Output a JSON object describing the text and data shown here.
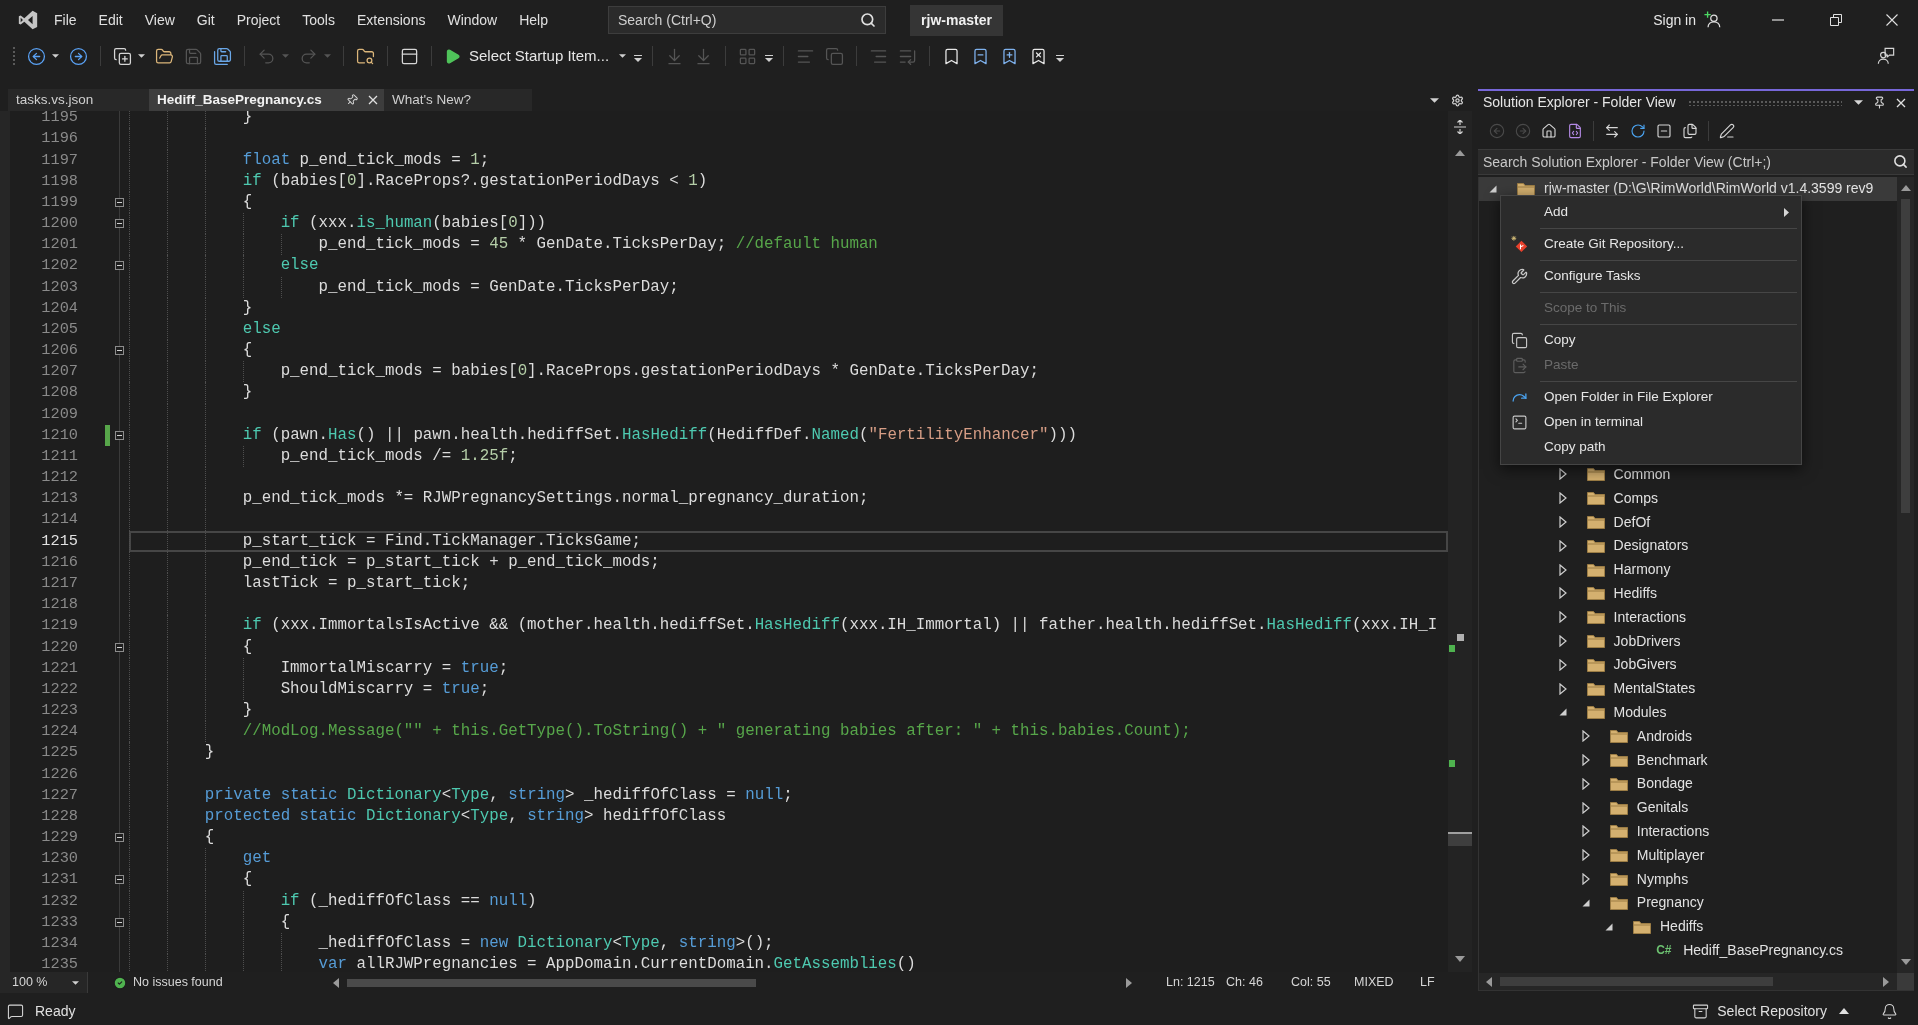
{
  "title_bar": {
    "menu": [
      "File",
      "Edit",
      "View",
      "Git",
      "Project",
      "Tools",
      "Extensions",
      "Window",
      "Help"
    ],
    "search": {
      "placeholder": "Search (Ctrl+Q)"
    },
    "solution": "rjw-master",
    "sign_in": "Sign in"
  },
  "toolbar": {
    "groups": [
      [
        {
          "kind": "icon",
          "disabled": false,
          "dropdown": true
        },
        {
          "kind": "icon",
          "disabled": false,
          "dropdown": false
        }
      ],
      [
        {
          "kind": "icon",
          "disabled": false,
          "dropdown": true
        },
        {
          "kind": "icon",
          "disabled": false,
          "dropdown": false
        },
        {
          "kind": "icon",
          "disabled": true,
          "dropdown": false
        },
        {
          "kind": "icon",
          "disabled": false,
          "dropdown": false
        }
      ],
      [
        {
          "kind": "icon",
          "disabled": true,
          "dropdown": true
        },
        {
          "kind": "icon",
          "disabled": true,
          "dropdown": true
        }
      ],
      [
        {
          "kind": "icon",
          "disabled": false,
          "dropdown": false
        }
      ],
      [
        {
          "kind": "icon",
          "disabled": false,
          "dropdown": false
        }
      ],
      [
        {
          "kind": "run",
          "label": "Select Startup Item...",
          "dropdown": true
        },
        {
          "kind": "overflow"
        }
      ],
      [
        {
          "kind": "icon",
          "disabled": true,
          "dropdown": false
        },
        {
          "kind": "icon",
          "disabled": true,
          "dropdown": false
        }
      ],
      [
        {
          "kind": "icon",
          "disabled": true,
          "dropdown": false
        },
        {
          "kind": "overflow"
        }
      ],
      [
        {
          "kind": "icon",
          "disabled": true,
          "dropdown": false
        },
        {
          "kind": "icon",
          "disabled": true,
          "dropdown": false
        }
      ],
      [
        {
          "kind": "icon",
          "disabled": true,
          "dropdown": false
        },
        {
          "kind": "icon",
          "disabled": true,
          "dropdown": false
        }
      ],
      [
        {
          "kind": "icon",
          "disabled": false,
          "dropdown": false
        },
        {
          "kind": "icon",
          "disabled": false,
          "dropdown": false
        },
        {
          "kind": "icon",
          "disabled": false,
          "dropdown": false
        },
        {
          "kind": "icon",
          "disabled": false,
          "dropdown": false
        },
        {
          "kind": "overflow"
        }
      ]
    ]
  },
  "editor": {
    "tabs": [
      {
        "label": "tasks.vs.json",
        "selected": false
      },
      {
        "label": "Hediff_BasePregnancy.cs",
        "selected": true
      },
      {
        "label": "What's New?",
        "selected": false
      }
    ],
    "lines": [
      {
        "number": "1195",
        "fold": false,
        "changed": false,
        "current": false,
        "tokens": [
          {
            "kind": "plain",
            "text": "            }"
          }
        ]
      },
      {
        "number": "1196",
        "fold": false,
        "changed": false,
        "current": false
      },
      {
        "number": "1197",
        "fold": false,
        "changed": false,
        "current": false,
        "tokens": [
          {
            "kind": "keyword",
            "text": "            float"
          },
          {
            "kind": "plain",
            "text": " p_end_tick_mods = "
          },
          {
            "kind": "number",
            "text": "1"
          },
          {
            "kind": "plain",
            "text": ";"
          }
        ]
      },
      {
        "number": "1198",
        "fold": false,
        "changed": false,
        "current": false,
        "tokens": [
          {
            "kind": "control",
            "text": "            if"
          },
          {
            "kind": "plain",
            "text": " (babies["
          },
          {
            "kind": "number",
            "text": "0"
          },
          {
            "kind": "plain",
            "text": "].RaceProps?.gestationPeriodDays < "
          },
          {
            "kind": "number",
            "text": "1"
          },
          {
            "kind": "plain",
            "text": ")"
          }
        ]
      },
      {
        "number": "1199",
        "fold": true,
        "changed": false,
        "current": false,
        "tokens": [
          {
            "kind": "plain",
            "text": "            {"
          }
        ]
      },
      {
        "number": "1200",
        "fold": true,
        "changed": false,
        "current": false,
        "tokens": [
          {
            "kind": "control",
            "text": "                if"
          },
          {
            "kind": "plain",
            "text": " (xxx."
          },
          {
            "kind": "method",
            "text": "is_human"
          },
          {
            "kind": "plain",
            "text": "(babies["
          },
          {
            "kind": "number",
            "text": "0"
          },
          {
            "kind": "plain",
            "text": "]))"
          }
        ]
      },
      {
        "number": "1201",
        "fold": false,
        "changed": false,
        "current": false,
        "tokens": [
          {
            "kind": "plain",
            "text": "                    p_end_tick_mods = "
          },
          {
            "kind": "number",
            "text": "45"
          },
          {
            "kind": "plain",
            "text": " * GenDate.TicksPerDay; "
          },
          {
            "kind": "comment",
            "text": "//default human"
          }
        ]
      },
      {
        "number": "1202",
        "fold": true,
        "changed": false,
        "current": false,
        "tokens": [
          {
            "kind": "control",
            "text": "                else"
          }
        ]
      },
      {
        "number": "1203",
        "fold": false,
        "changed": false,
        "current": false,
        "tokens": [
          {
            "kind": "plain",
            "text": "                    p_end_tick_mods = GenDate.TicksPerDay;"
          }
        ]
      },
      {
        "number": "1204",
        "fold": false,
        "changed": false,
        "current": false,
        "tokens": [
          {
            "kind": "plain",
            "text": "            }"
          }
        ]
      },
      {
        "number": "1205",
        "fold": false,
        "changed": false,
        "current": false,
        "tokens": [
          {
            "kind": "control",
            "text": "            else"
          }
        ]
      },
      {
        "number": "1206",
        "fold": true,
        "changed": false,
        "current": false,
        "tokens": [
          {
            "kind": "plain",
            "text": "            {"
          }
        ]
      },
      {
        "number": "1207",
        "fold": false,
        "changed": false,
        "current": false,
        "tokens": [
          {
            "kind": "plain",
            "text": "                p_end_tick_mods = babies["
          },
          {
            "kind": "number",
            "text": "0"
          },
          {
            "kind": "plain",
            "text": "].RaceProps.gestationPeriodDays * GenDate.TicksPerDay;"
          }
        ]
      },
      {
        "number": "1208",
        "fold": false,
        "changed": false,
        "current": false,
        "tokens": [
          {
            "kind": "plain",
            "text": "            }"
          }
        ]
      },
      {
        "number": "1209",
        "fold": false,
        "changed": false,
        "current": false
      },
      {
        "number": "1210",
        "fold": true,
        "changed": true,
        "current": false,
        "tokens": [
          {
            "kind": "control",
            "text": "            if"
          },
          {
            "kind": "plain",
            "text": " (pawn."
          },
          {
            "kind": "method",
            "text": "Has"
          },
          {
            "kind": "plain",
            "text": "() || pawn.health.hediffSet."
          },
          {
            "kind": "method",
            "text": "HasHediff"
          },
          {
            "kind": "plain",
            "text": "(HediffDef."
          },
          {
            "kind": "method",
            "text": "Named"
          },
          {
            "kind": "plain",
            "text": "("
          },
          {
            "kind": "string",
            "text": "\"FertilityEnhancer\""
          },
          {
            "kind": "plain",
            "text": ")))"
          }
        ]
      },
      {
        "number": "1211",
        "fold": false,
        "changed": false,
        "current": false,
        "tokens": [
          {
            "kind": "plain",
            "text": "                p_end_tick_mods /= "
          },
          {
            "kind": "number",
            "text": "1.25f"
          },
          {
            "kind": "plain",
            "text": ";"
          }
        ]
      },
      {
        "number": "1212",
        "fold": false,
        "changed": false,
        "current": false
      },
      {
        "number": "1213",
        "fold": false,
        "changed": false,
        "current": false,
        "tokens": [
          {
            "kind": "plain",
            "text": "            p_end_tick_mods *= RJWPregnancySettings.normal_pregnancy_duration;"
          }
        ]
      },
      {
        "number": "1214",
        "fold": false,
        "changed": false,
        "current": false
      },
      {
        "number": "1215",
        "fold": false,
        "changed": false,
        "current": true,
        "tokens": [
          {
            "kind": "plain",
            "text": "            p_start_tick = Find.TickManager.TicksGame;"
          }
        ]
      },
      {
        "number": "1216",
        "fold": false,
        "changed": false,
        "current": false,
        "tokens": [
          {
            "kind": "plain",
            "text": "            p_end_tick = p_start_tick + p_end_tick_mods;"
          }
        ]
      },
      {
        "number": "1217",
        "fold": false,
        "changed": false,
        "current": false,
        "tokens": [
          {
            "kind": "plain",
            "text": "            lastTick = p_start_tick;"
          }
        ]
      },
      {
        "number": "1218",
        "fold": false,
        "changed": false,
        "current": false
      },
      {
        "number": "1219",
        "fold": false,
        "changed": false,
        "current": false,
        "tokens": [
          {
            "kind": "control",
            "text": "            if"
          },
          {
            "kind": "plain",
            "text": " (xxx.ImmortalsIsActive && (mother.health.hediffSet."
          },
          {
            "kind": "method",
            "text": "HasHediff"
          },
          {
            "kind": "plain",
            "text": "(xxx.IH_Immortal) || father.health.hediffSet."
          },
          {
            "kind": "method",
            "text": "HasHediff"
          },
          {
            "kind": "plain",
            "text": "(xxx.IH_I"
          }
        ]
      },
      {
        "number": "1220",
        "fold": true,
        "changed": false,
        "current": false,
        "tokens": [
          {
            "kind": "plain",
            "text": "            {"
          }
        ]
      },
      {
        "number": "1221",
        "fold": false,
        "changed": false,
        "current": false,
        "tokens": [
          {
            "kind": "plain",
            "text": "                ImmortalMiscarry = "
          },
          {
            "kind": "keyword",
            "text": "true"
          },
          {
            "kind": "plain",
            "text": ";"
          }
        ]
      },
      {
        "number": "1222",
        "fold": false,
        "changed": false,
        "current": false,
        "tokens": [
          {
            "kind": "plain",
            "text": "                ShouldMiscarry = "
          },
          {
            "kind": "keyword",
            "text": "true"
          },
          {
            "kind": "plain",
            "text": ";"
          }
        ]
      },
      {
        "number": "1223",
        "fold": false,
        "changed": false,
        "current": false,
        "tokens": [
          {
            "kind": "plain",
            "text": "            }"
          }
        ]
      },
      {
        "number": "1224",
        "fold": false,
        "changed": false,
        "current": false,
        "tokens": [
          {
            "kind": "comment",
            "text": "            //ModLog.Message(\"\" + this.GetType().ToString() + \" generating babies after: \" + this.babies.Count);"
          }
        ]
      },
      {
        "number": "1225",
        "fold": false,
        "changed": false,
        "current": false,
        "tokens": [
          {
            "kind": "plain",
            "text": "        }"
          }
        ]
      },
      {
        "number": "1226",
        "fold": false,
        "changed": false,
        "current": false
      },
      {
        "number": "1227",
        "fold": false,
        "changed": false,
        "current": false,
        "tokens": [
          {
            "kind": "keyword",
            "text": "        private static "
          },
          {
            "kind": "type",
            "text": "Dictionary"
          },
          {
            "kind": "plain",
            "text": "<"
          },
          {
            "kind": "type",
            "text": "Type"
          },
          {
            "kind": "plain",
            "text": ", "
          },
          {
            "kind": "keyword",
            "text": "string"
          },
          {
            "kind": "plain",
            "text": "> _hediffOfClass = "
          },
          {
            "kind": "keyword",
            "text": "null"
          },
          {
            "kind": "plain",
            "text": ";"
          }
        ]
      },
      {
        "number": "1228",
        "fold": false,
        "changed": false,
        "current": false,
        "tokens": [
          {
            "kind": "keyword",
            "text": "        protected static "
          },
          {
            "kind": "type",
            "text": "Dictionary"
          },
          {
            "kind": "plain",
            "text": "<"
          },
          {
            "kind": "type",
            "text": "Type"
          },
          {
            "kind": "plain",
            "text": ", "
          },
          {
            "kind": "keyword",
            "text": "string"
          },
          {
            "kind": "plain",
            "text": "> hediffOfClass"
          }
        ]
      },
      {
        "number": "1229",
        "fold": true,
        "changed": false,
        "current": false,
        "tokens": [
          {
            "kind": "plain",
            "text": "        {"
          }
        ]
      },
      {
        "number": "1230",
        "fold": false,
        "changed": false,
        "current": false,
        "tokens": [
          {
            "kind": "keyword",
            "text": "            get"
          }
        ]
      },
      {
        "number": "1231",
        "fold": true,
        "changed": false,
        "current": false,
        "tokens": [
          {
            "kind": "plain",
            "text": "            {"
          }
        ]
      },
      {
        "number": "1232",
        "fold": false,
        "changed": false,
        "current": false,
        "tokens": [
          {
            "kind": "control",
            "text": "                if"
          },
          {
            "kind": "plain",
            "text": " (_hediffOfClass == "
          },
          {
            "kind": "keyword",
            "text": "null"
          },
          {
            "kind": "plain",
            "text": ")"
          }
        ]
      },
      {
        "number": "1233",
        "fold": true,
        "changed": false,
        "current": false,
        "tokens": [
          {
            "kind": "plain",
            "text": "                {"
          }
        ]
      },
      {
        "number": "1234",
        "fold": false,
        "changed": false,
        "current": false,
        "tokens": [
          {
            "kind": "plain",
            "text": "                    _hediffOfClass = "
          },
          {
            "kind": "keyword",
            "text": "new "
          },
          {
            "kind": "type",
            "text": "Dictionary"
          },
          {
            "kind": "plain",
            "text": "<"
          },
          {
            "kind": "type",
            "text": "Type"
          },
          {
            "kind": "plain",
            "text": ", "
          },
          {
            "kind": "keyword",
            "text": "string"
          },
          {
            "kind": "plain",
            "text": ">();"
          }
        ]
      },
      {
        "number": "1235",
        "fold": false,
        "changed": false,
        "current": false,
        "tokens": [
          {
            "kind": "keyword",
            "text": "                    var"
          },
          {
            "kind": "plain",
            "text": " allRJWPregnancies = AppDomain.CurrentDomain."
          },
          {
            "kind": "method",
            "text": "GetAssemblies"
          },
          {
            "kind": "plain",
            "text": "()"
          }
        ]
      }
    ],
    "status": {
      "zoom": "100 %",
      "issues": "No issues found",
      "position": [
        "Ln: 1215",
        "Ch: 46",
        "Col: 55"
      ],
      "indentation": "MIXED",
      "line_endings": "LF"
    }
  },
  "solution_explorer": {
    "title": "Solution Explorer - Folder View",
    "toolbar": [
      [
        {
          "disabled": true
        },
        {
          "disabled": true
        },
        {
          "disabled": false
        },
        {
          "disabled": false
        }
      ],
      [
        {
          "disabled": false
        },
        {
          "disabled": false
        },
        {
          "disabled": false
        },
        {
          "disabled": false
        }
      ],
      [
        {
          "disabled": false
        }
      ]
    ],
    "search": {
      "placeholder": "Search Solution Explorer - Folder View (Ctrl+;)"
    },
    "tree": {
      "root": {
        "label": "rjw-master (D:\\G\\RimWorld\\RimWorld v1.4.3599 rev9",
        "kind": "folder",
        "expanded": true,
        "selected": true
      },
      "items": [
        {
          "label": "Common",
          "kind": "folder",
          "expanded": false,
          "selected": false
        },
        {
          "label": "Comps",
          "kind": "folder",
          "expanded": false,
          "selected": false
        },
        {
          "label": "DefOf",
          "kind": "folder",
          "expanded": false,
          "selected": false
        },
        {
          "label": "Designators",
          "kind": "folder",
          "expanded": false,
          "selected": false
        },
        {
          "label": "Harmony",
          "kind": "folder",
          "expanded": false,
          "selected": false
        },
        {
          "label": "Hediffs",
          "kind": "folder",
          "expanded": false,
          "selected": false
        },
        {
          "label": "Interactions",
          "kind": "folder",
          "expanded": false,
          "selected": false
        },
        {
          "label": "JobDrivers",
          "kind": "folder",
          "expanded": false,
          "selected": false
        },
        {
          "label": "JobGivers",
          "kind": "folder",
          "expanded": false,
          "selected": false
        },
        {
          "label": "MentalStates",
          "kind": "folder",
          "expanded": false,
          "selected": false
        },
        {
          "label": "Modules",
          "kind": "folder",
          "expanded": true,
          "selected": false,
          "children": [
            {
              "label": "Androids",
              "kind": "folder",
              "expanded": false,
              "selected": false
            },
            {
              "label": "Benchmark",
              "kind": "folder",
              "expanded": false,
              "selected": false
            },
            {
              "label": "Bondage",
              "kind": "folder",
              "expanded": false,
              "selected": false
            },
            {
              "label": "Genitals",
              "kind": "folder",
              "expanded": false,
              "selected": false
            },
            {
              "label": "Interactions",
              "kind": "folder",
              "expanded": false,
              "selected": false
            },
            {
              "label": "Multiplayer",
              "kind": "folder",
              "expanded": false,
              "selected": false
            },
            {
              "label": "Nymphs",
              "kind": "folder",
              "expanded": false,
              "selected": false
            },
            {
              "label": "Pregnancy",
              "kind": "folder",
              "expanded": true,
              "selected": false,
              "children": [
                {
                  "label": "Hediffs",
                  "kind": "folder",
                  "expanded": true,
                  "selected": false,
                  "children": [
                    {
                      "label": "Hediff_BasePregnancy.cs",
                      "kind": "file",
                      "glyph": "C#",
                      "selected": false
                    }
                  ]
                }
              ]
            }
          ]
        }
      ]
    }
  },
  "context_menu": {
    "groups": [
      [
        {
          "label": "Add",
          "disabled": false,
          "submenu": true
        }
      ],
      [
        {
          "label": "Create Git Repository...",
          "disabled": false,
          "submenu": false
        }
      ],
      [
        {
          "label": "Configure Tasks",
          "disabled": false,
          "submenu": false
        }
      ],
      [
        {
          "label": "Scope to This",
          "disabled": true,
          "submenu": false
        }
      ],
      [
        {
          "label": "Copy",
          "disabled": false,
          "submenu": false
        },
        {
          "label": "Paste",
          "disabled": true,
          "submenu": false
        }
      ],
      [
        {
          "label": "Open Folder in File Explorer",
          "disabled": false,
          "submenu": false
        },
        {
          "label": "Open in terminal",
          "disabled": false,
          "submenu": false
        },
        {
          "label": "Copy path",
          "disabled": false,
          "submenu": false
        }
      ]
    ]
  },
  "status_bar": {
    "message": "Ready",
    "repository": "Select Repository"
  }
}
